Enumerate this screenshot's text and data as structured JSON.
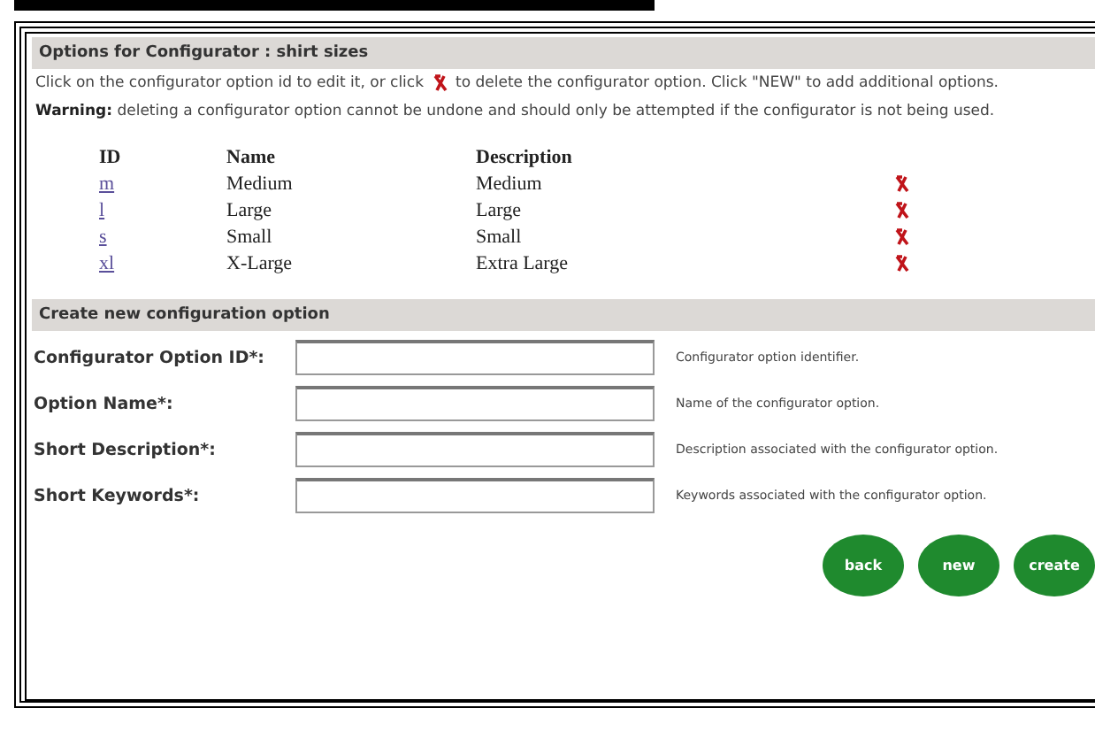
{
  "options_panel": {
    "title": "Options for Configurator : shirt sizes",
    "intro_before": "Click on the configurator option id to edit it, or click",
    "intro_after": "to delete the configurator option. Click \"NEW\" to add additional options.",
    "warning": "**Warning:** deleting a configurator option cannot be undone and should only be attempted if the configurator is not being used.",
    "columns": [
      "ID",
      "Name",
      "Description"
    ],
    "rows": [
      {
        "id": "m",
        "name": "Medium",
        "description": "Medium"
      },
      {
        "id": "l",
        "name": "Large",
        "description": "Large"
      },
      {
        "id": "s",
        "name": "Small",
        "description": "Small"
      },
      {
        "id": "xl",
        "name": "X-Large",
        "description": "Extra Large"
      }
    ]
  },
  "create_panel": {
    "title": "Create new configuration option",
    "fields": [
      {
        "label": "Configurator Option ID*:",
        "hint": "Configurator option identifier."
      },
      {
        "label": "Option Name*:",
        "hint": "Name of the configurator option."
      },
      {
        "label": "Short Description*:",
        "hint": "Description associated with the configurator option."
      },
      {
        "label": "Short Keywords*:",
        "hint": "Keywords associated with the configurator option."
      }
    ],
    "buttons": [
      "back",
      "new",
      "create"
    ]
  }
}
